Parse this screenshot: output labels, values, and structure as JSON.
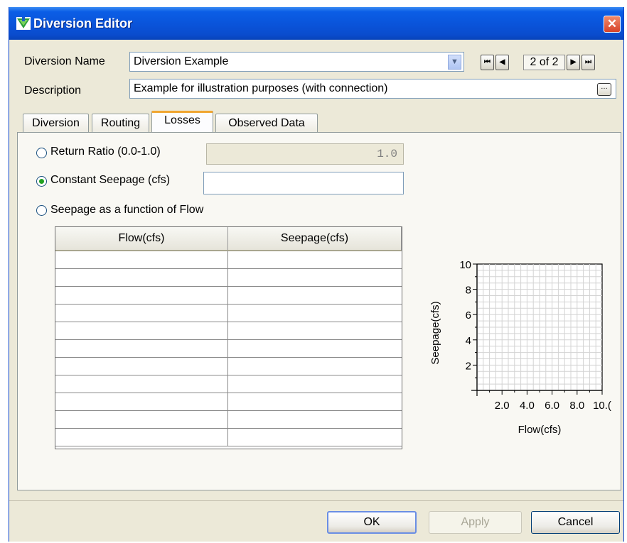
{
  "window": {
    "title": "Diversion Editor",
    "close_glyph": "✕"
  },
  "diversion_name": {
    "label": "Diversion Name",
    "value": "Diversion Example",
    "dropdown_glyph": "▼"
  },
  "navigation": {
    "first": "⏮",
    "prev": "◀",
    "count": "2 of 2",
    "next": "▶",
    "last": "⏭"
  },
  "description": {
    "label": "Description",
    "value": "Example for illustration purposes (with connection)",
    "button_glyph": "…"
  },
  "tabs": [
    {
      "label": "Diversion",
      "active": false
    },
    {
      "label": "Routing",
      "active": false
    },
    {
      "label": "Losses",
      "active": true
    },
    {
      "label": "Observed Data",
      "active": false
    }
  ],
  "losses": {
    "return_ratio": {
      "label": "Return Ratio (0.0-1.0)",
      "value": "1.0",
      "selected": false
    },
    "constant_seepage": {
      "label": "Constant Seepage (cfs)",
      "value": "",
      "selected": true
    },
    "seepage_function": {
      "label": "Seepage as a function of Flow",
      "selected": false
    }
  },
  "table": {
    "columns": [
      "Flow(cfs)",
      "Seepage(cfs)"
    ],
    "rows": [
      [
        "",
        ""
      ],
      [
        "",
        ""
      ],
      [
        "",
        ""
      ],
      [
        "",
        ""
      ],
      [
        "",
        ""
      ],
      [
        "",
        ""
      ],
      [
        "",
        ""
      ],
      [
        "",
        ""
      ],
      [
        "",
        ""
      ],
      [
        "",
        ""
      ],
      [
        "",
        ""
      ]
    ]
  },
  "chart_data": {
    "type": "line",
    "x": [],
    "series": [],
    "xlabel": "Flow(cfs)",
    "ylabel": "Seepage(cfs)",
    "xticks": [
      "2.0",
      "4.0",
      "6.0",
      "8.0",
      "10.("
    ],
    "yticks": [
      "2",
      "4",
      "6",
      "8",
      "10"
    ],
    "xlim": [
      0,
      10
    ],
    "ylim": [
      0,
      10
    ],
    "grid": true
  },
  "buttons": {
    "ok": "OK",
    "apply": "Apply",
    "cancel": "Cancel"
  }
}
